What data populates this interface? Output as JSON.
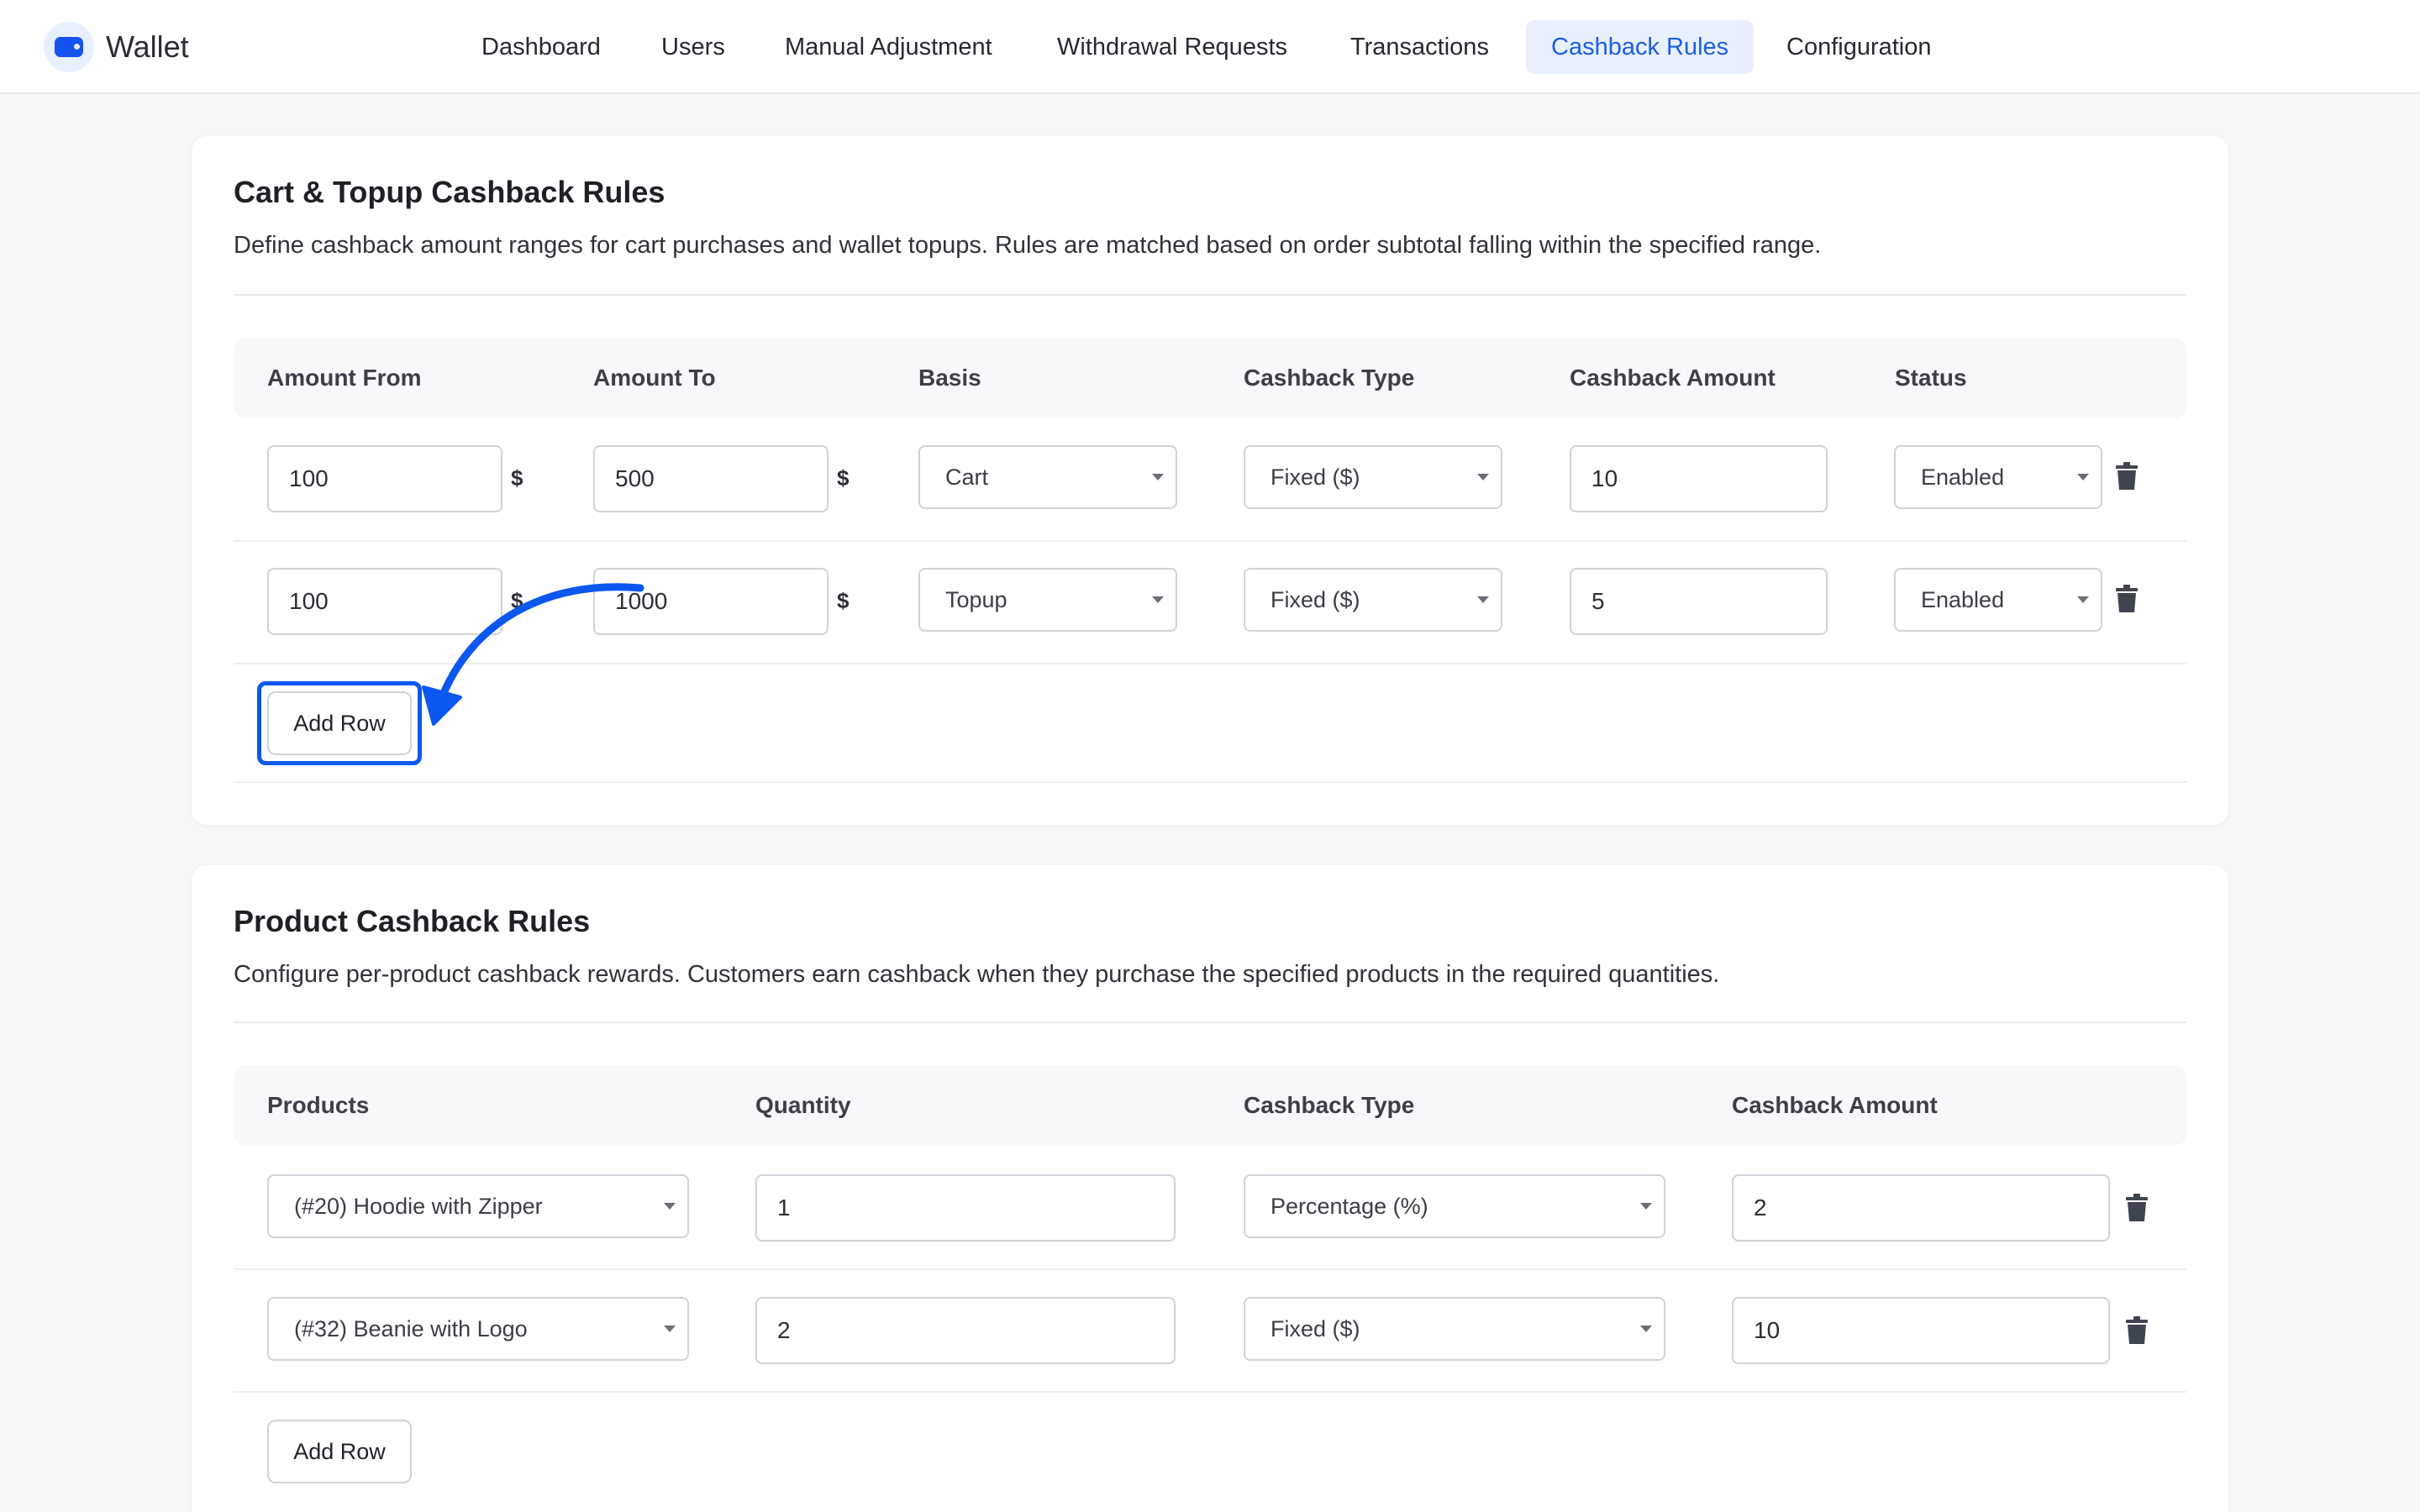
{
  "app": {
    "name": "Wallet",
    "logo_icon": "wallet-icon",
    "accent_color": "#1a5ee6"
  },
  "nav": {
    "items": [
      {
        "label": "Dashboard"
      },
      {
        "label": "Users"
      },
      {
        "label": "Manual Adjustment"
      },
      {
        "label": "Withdrawal Requests"
      },
      {
        "label": "Transactions"
      },
      {
        "label": "Cashback Rules"
      },
      {
        "label": "Configuration"
      }
    ],
    "active": "Cashback Rules"
  },
  "cart_rules": {
    "title": "Cart & Topup Cashback Rules",
    "description": "Define cashback amount ranges for cart purchases and wallet topups. Rules are matched based on order subtotal falling within the specified range.",
    "columns": [
      "Amount From",
      "Amount To",
      "Basis",
      "Cashback Type",
      "Cashback Amount",
      "Status"
    ],
    "currency_symbol": "$",
    "rows": [
      {
        "amount_from": "100",
        "amount_to": "500",
        "basis": "Cart",
        "cashback_type": "Fixed ($)",
        "cashback_amount": "10",
        "status": "Enabled"
      },
      {
        "amount_from": "100",
        "amount_to": "1000",
        "basis": "Topup",
        "cashback_type": "Fixed ($)",
        "cashback_amount": "5",
        "status": "Enabled"
      }
    ],
    "add_row_label": "Add Row"
  },
  "product_rules": {
    "title": "Product Cashback Rules",
    "description": "Configure per-product cashback rewards. Customers earn cashback when they purchase the specified products in the required quantities.",
    "columns": [
      "Products",
      "Quantity",
      "Cashback Type",
      "Cashback Amount"
    ],
    "rows": [
      {
        "product": "(#20) Hoodie with Zipper",
        "quantity": "1",
        "cashback_type": "Percentage (%)",
        "cashback_amount": "2"
      },
      {
        "product": "(#32) Beanie with Logo",
        "quantity": "2",
        "cashback_type": "Fixed ($)",
        "cashback_amount": "10"
      }
    ],
    "add_row_label": "Add Row"
  },
  "annotation": {
    "highlight_color": "#0b57f0",
    "target": "Add Row"
  }
}
